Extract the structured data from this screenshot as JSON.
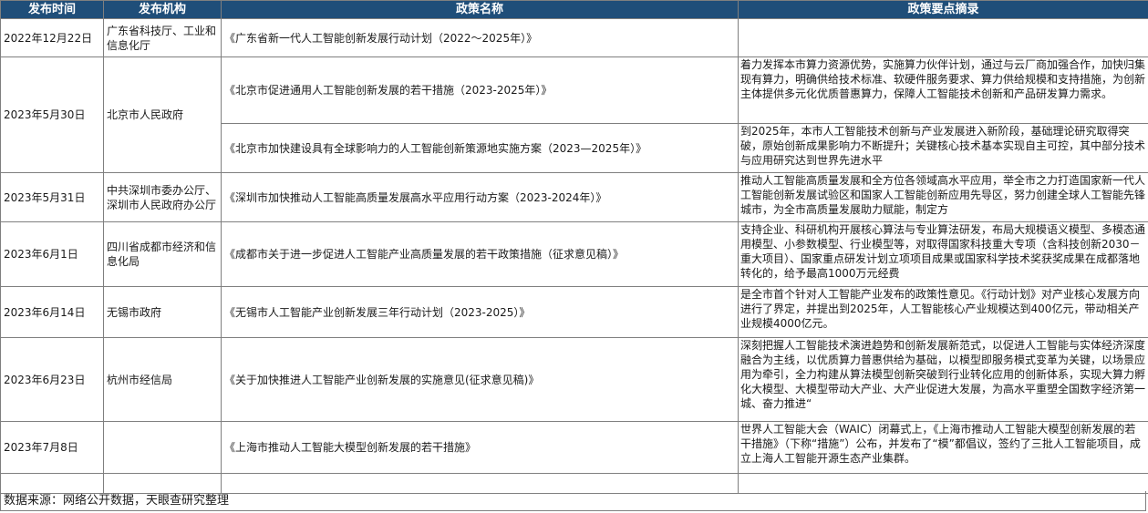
{
  "headers": {
    "date": "发布时间",
    "org": "发布机构",
    "policy": "政策名称",
    "summary": "政策要点摘录"
  },
  "rows": [
    {
      "date": "2022年12月22日",
      "org": "广东省科技厅、工业和信息化厅",
      "policy": "《广东省新一代人工智能创新发展行动计划（2022～2025年）》",
      "summary": ""
    },
    {
      "date": "2023年5月30日",
      "org": "北京市人民政府",
      "policy": "《北京市促进通用人工智能创新发展的若干措施（2023-2025年）》",
      "summary": "着力发挥本市算力资源优势，实施算力伙伴计划，通过与云厂商加强合作，加快归集现有算力，明确供给技术标准、软硬件服务要求、算力供给规模和支持措施，为创新主体提供多元化优质普惠算力，保障人工智能技术创新和产品研发算力需求。"
    },
    {
      "policy": "《北京市加快建设具有全球影响力的人工智能创新策源地实施方案（2023—2025年）》",
      "summary": "到2025年，本市人工智能技术创新与产业发展进入新阶段，基础理论研究取得突破，原始创新成果影响力不断提升；关键核心技术基本实现自主可控，其中部分技术与应用研究达到世界先进水平"
    },
    {
      "date": "2023年5月31日",
      "org": "中共深圳市委办公厅、深圳市人民政府办公厅",
      "policy": "《深圳市加快推动人工智能高质量发展高水平应用行动方案（2023-2024年）》",
      "summary": "推动人工智能高质量发展和全方位各领域高水平应用，举全市之力打造国家新一代人工智能创新发展试验区和国家人工智能创新应用先导区，努力创建全球人工智能先锋城市，为全市高质量发展助力赋能，制定方"
    },
    {
      "date": "2023年6月1日",
      "org": "四川省成都市经济和信息化局",
      "policy": "《成都市关于进一步促进人工智能产业高质量发展的若干政策措施（征求意见稿）》",
      "summary": "支持企业、科研机构开展核心算法与专业算法研发，布局大规模语义模型、多模态通用模型、小参数模型、行业模型等，对取得国家科技重大专项（含科技创新2030－重大项目）、国家重点研发计划立项项目成果或国家科学技术奖获奖成果在成都落地转化的，给予最高1000万元经费"
    },
    {
      "date": "2023年6月14日",
      "org": "无锡市政府",
      "policy": "《无锡市人工智能产业创新发展三年行动计划（2023-2025）》",
      "summary": "是全市首个针对人工智能产业发布的政策性意见。《行动计划》对产业核心发展方向进行了界定，并提出到2025年，人工智能核心产业规模达到400亿元，带动相关产业规模4000亿元。"
    },
    {
      "date": "2023年6月23日",
      "org": "杭州市经信局",
      "policy": "《关于加快推进人工智能产业创新发展的实施意见(征求意见稿)》",
      "summary": "深刻把握人工智能技术演进趋势和创新发展新范式，以促进人工智能与实体经济深度融合为主线，以优质算力普惠供给为基础，以模型即服务模式变革为关键，以场景应用为牵引，全力构建从算法模型创新突破到行业转化应用的创新体系，实现大算力孵化大模型、大模型带动大产业、大产业促进大发展，为高水平重塑全国数字经济第一城、奋力推进“"
    },
    {
      "date": "2023年7月8日",
      "org": "",
      "policy": "《上海市推动人工智能大模型创新发展的若干措施》",
      "summary": "世界人工智能大会（WAIC）闭幕式上，《上海市推动人工智能大模型创新发展的若干措施》（下称“措施”）公布，并发布了“模”都倡议，签约了三批人工智能项目，成立上海人工智能开源生态产业集群。"
    }
  ],
  "footer": "数据来源：网络公开数据，天眼查研究整理"
}
